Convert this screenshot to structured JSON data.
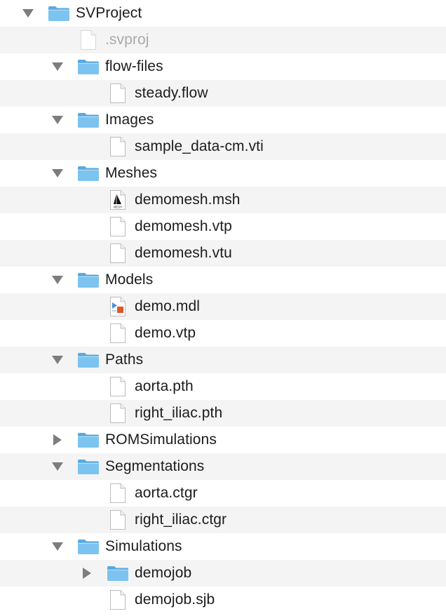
{
  "tree": {
    "rows": [
      {
        "label": "SVProject",
        "type": "folder",
        "level": 0,
        "expanded": true
      },
      {
        "label": ".svproj",
        "type": "file-hidden",
        "level": 1
      },
      {
        "label": "flow-files",
        "type": "folder",
        "level": 1,
        "expanded": true
      },
      {
        "label": "steady.flow",
        "type": "file",
        "level": 2
      },
      {
        "label": "Images",
        "type": "folder",
        "level": 1,
        "expanded": true
      },
      {
        "label": "sample_data-cm.vti",
        "type": "file",
        "level": 2
      },
      {
        "label": "Meshes",
        "type": "folder",
        "level": 1,
        "expanded": true
      },
      {
        "label": "demomesh.msh",
        "type": "file-mesh",
        "level": 2,
        "icon_text": "MESH"
      },
      {
        "label": "demomesh.vtp",
        "type": "file",
        "level": 2
      },
      {
        "label": "demomesh.vtu",
        "type": "file",
        "level": 2
      },
      {
        "label": "Models",
        "type": "folder",
        "level": 1,
        "expanded": true
      },
      {
        "label": "demo.mdl",
        "type": "file-model",
        "level": 2
      },
      {
        "label": "demo.vtp",
        "type": "file",
        "level": 2
      },
      {
        "label": "Paths",
        "type": "folder",
        "level": 1,
        "expanded": true
      },
      {
        "label": "aorta.pth",
        "type": "file",
        "level": 2
      },
      {
        "label": "right_iliac.pth",
        "type": "file",
        "level": 2
      },
      {
        "label": "ROMSimulations",
        "type": "folder",
        "level": 1,
        "expanded": false
      },
      {
        "label": "Segmentations",
        "type": "folder",
        "level": 1,
        "expanded": true
      },
      {
        "label": "aorta.ctgr",
        "type": "file",
        "level": 2
      },
      {
        "label": "right_iliac.ctgr",
        "type": "file",
        "level": 2
      },
      {
        "label": "Simulations",
        "type": "folder",
        "level": 1,
        "expanded": true
      },
      {
        "label": "demojob",
        "type": "folder",
        "level": 2,
        "expanded": false
      },
      {
        "label": "demojob.sjb",
        "type": "file",
        "level": 2
      }
    ]
  },
  "colors": {
    "folder_front": "#7cc3f0",
    "folder_back": "#5aa9e0",
    "row_alt": "#f4f4f4",
    "text": "#1c1c1c",
    "hidden_text": "#a9a9a9",
    "disclosure": "#7d7d7d"
  }
}
